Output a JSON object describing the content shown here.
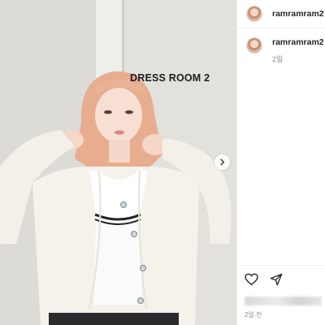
{
  "post": {
    "username": "ramramram2",
    "caption_time": "2일",
    "footer_time": "2일 전"
  },
  "photo": {
    "sign_text": "DRESS ROOM 2"
  },
  "icons": {
    "like": "heart-icon",
    "share": "send-icon",
    "next": "chevron-right-icon"
  },
  "colors": {
    "wall": "#e4e3df",
    "hair": "#e7a98d",
    "cardigan": "#f4f1ea",
    "accent_text": "#262626",
    "muted_text": "#8e8e8e"
  }
}
